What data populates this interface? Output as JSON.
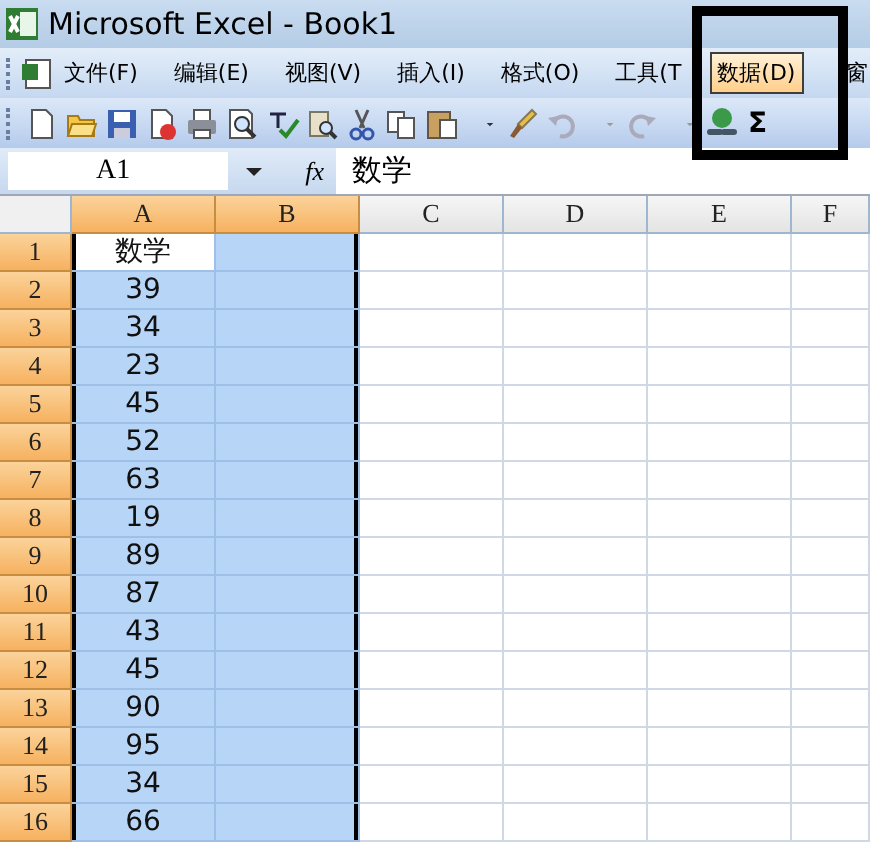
{
  "window": {
    "title": "Microsoft Excel - Book1"
  },
  "menu": [
    {
      "label": "文件(F)",
      "selected": false
    },
    {
      "label": "编辑(E)",
      "selected": false
    },
    {
      "label": "视图(V)",
      "selected": false
    },
    {
      "label": "插入(I)",
      "selected": false
    },
    {
      "label": "格式(O)",
      "selected": false
    },
    {
      "label": "工具(T",
      "selected": false
    },
    {
      "label": "数据(D)",
      "selected": true
    },
    {
      "label": "窗",
      "selected": false
    }
  ],
  "toolbar": {
    "sum_label": "Σ"
  },
  "annotation": {
    "kind": "frame"
  },
  "formula_bar": {
    "name_box": "A1",
    "function_label": "fx",
    "value": "数学"
  },
  "columns": [
    {
      "label": "A",
      "selected": true
    },
    {
      "label": "B",
      "selected": true
    },
    {
      "label": "C",
      "selected": false
    },
    {
      "label": "D",
      "selected": false
    },
    {
      "label": "E",
      "selected": false
    },
    {
      "label": "F",
      "selected": false
    }
  ],
  "rows": [
    {
      "header": "1",
      "selected": true,
      "cells": [
        {
          "text": "数学",
          "active": true
        },
        {
          "active": false
        }
      ]
    },
    {
      "header": "2",
      "selected": true,
      "cells": [
        {
          "text": "39",
          "active": false
        },
        {
          "active": false
        }
      ]
    },
    {
      "header": "3",
      "selected": true,
      "cells": [
        {
          "text": "34",
          "active": false
        },
        {
          "active": false
        }
      ]
    },
    {
      "header": "4",
      "selected": true,
      "cells": [
        {
          "text": "23",
          "active": false
        },
        {
          "active": false
        }
      ]
    },
    {
      "header": "5",
      "selected": true,
      "cells": [
        {
          "text": "45",
          "active": false
        },
        {
          "active": false
        }
      ]
    },
    {
      "header": "6",
      "selected": true,
      "cells": [
        {
          "text": "52",
          "active": false
        },
        {
          "active": false
        }
      ]
    },
    {
      "header": "7",
      "selected": true,
      "cells": [
        {
          "text": "63",
          "active": false
        },
        {
          "active": false
        }
      ]
    },
    {
      "header": "8",
      "selected": true,
      "cells": [
        {
          "text": "19",
          "active": false
        },
        {
          "active": false
        }
      ]
    },
    {
      "header": "9",
      "selected": true,
      "cells": [
        {
          "text": "89",
          "active": false
        },
        {
          "active": false
        }
      ]
    },
    {
      "header": "10",
      "selected": true,
      "cells": [
        {
          "text": "87",
          "active": false
        },
        {
          "active": false
        }
      ]
    },
    {
      "header": "11",
      "selected": true,
      "cells": [
        {
          "text": "43",
          "active": false
        },
        {
          "active": false
        }
      ]
    },
    {
      "header": "12",
      "selected": true,
      "cells": [
        {
          "text": "45",
          "active": false
        },
        {
          "active": false
        }
      ]
    },
    {
      "header": "13",
      "selected": true,
      "cells": [
        {
          "text": "90",
          "active": false
        },
        {
          "active": false
        }
      ]
    },
    {
      "header": "14",
      "selected": true,
      "cells": [
        {
          "text": "95",
          "active": false
        },
        {
          "active": false
        }
      ]
    },
    {
      "header": "15",
      "selected": true,
      "cells": [
        {
          "text": "34",
          "active": false
        },
        {
          "active": false
        }
      ]
    },
    {
      "header": "16",
      "selected": true,
      "cells": [
        {
          "text": "66",
          "active": false
        },
        {
          "active": false
        }
      ]
    }
  ]
}
